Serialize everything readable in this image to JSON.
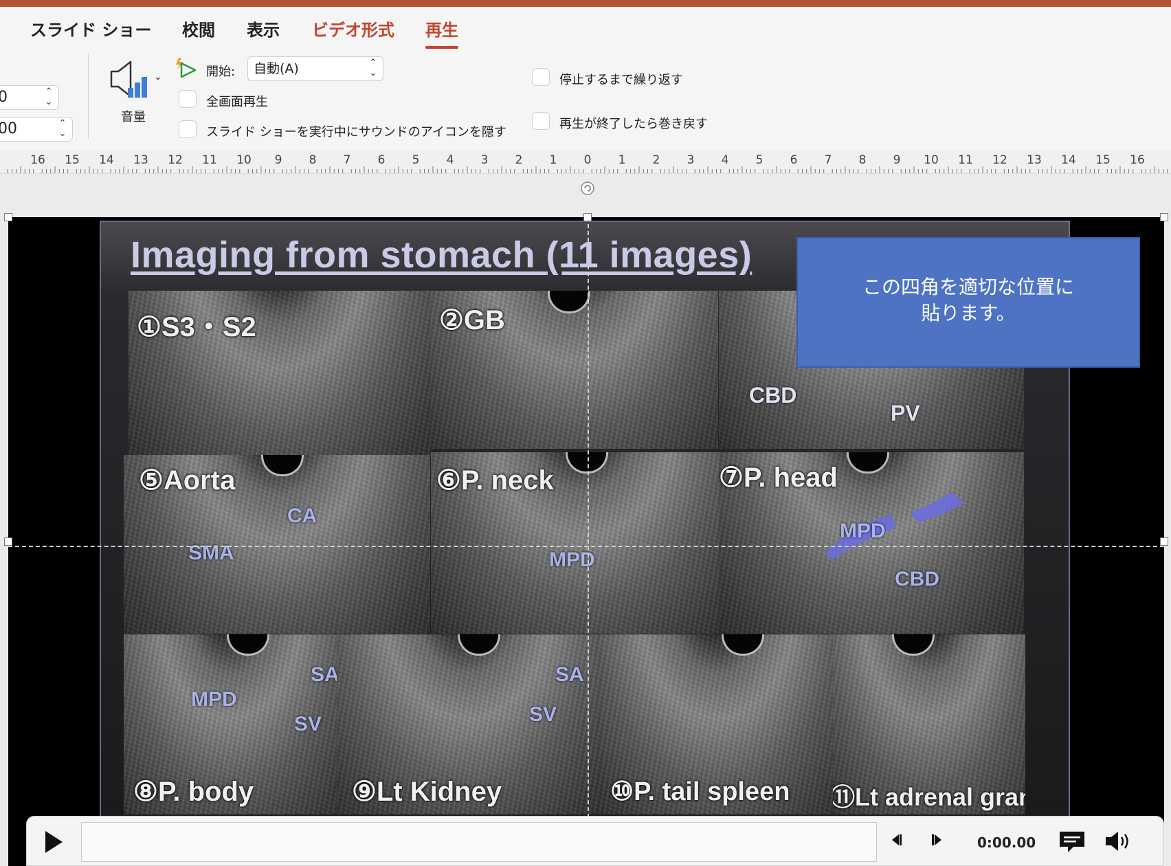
{
  "ribbon": {
    "tabs": [
      {
        "label": "スライド ショー"
      },
      {
        "label": "校閲"
      },
      {
        "label": "表示"
      },
      {
        "label": "ビデオ形式"
      },
      {
        "label": "再生"
      }
    ],
    "active_tab": "再生",
    "fade_in_value": "0",
    "fade_out_value": "00",
    "volume_label": "音量",
    "start_label": "開始:",
    "start_value": "自動(A)",
    "fullscreen_label": "全画面再生",
    "hide_icon_label": "スライド ショーを実行中にサウンドのアイコンを隠す",
    "loop_label": "停止するまで繰り返す",
    "rewind_label": "再生が終了したら巻き戻す",
    "accent_color": "#c0462f"
  },
  "ruler": {
    "left_numbers": [
      "16",
      "15",
      "14",
      "13",
      "12",
      "11",
      "10",
      "9",
      "8",
      "7",
      "6",
      "5",
      "4",
      "3",
      "2",
      "1",
      "0"
    ],
    "right_numbers": [
      "1",
      "2",
      "3",
      "4",
      "5",
      "6",
      "7",
      "8",
      "9",
      "10",
      "11",
      "12",
      "13",
      "14",
      "15",
      "16"
    ]
  },
  "slide": {
    "title": "Imaging from stomach (11 images)",
    "blue_box_text_line1": "この四角を適切な位置に",
    "blue_box_text_line2": "貼ります。",
    "panels": [
      {
        "title": "①S3・S2",
        "labels": []
      },
      {
        "title": "②GB",
        "labels": []
      },
      {
        "title": "",
        "labels": [
          "CBD",
          "PV"
        ]
      },
      {
        "title": "⑤Aorta",
        "labels": [
          "CA",
          "SMA"
        ]
      },
      {
        "title": "⑥P. neck",
        "labels": [
          "MPD"
        ]
      },
      {
        "title": "⑦P. head",
        "labels": [
          "MPD",
          "CBD"
        ]
      },
      {
        "title": "⑧P. body",
        "labels": [
          "MPD",
          "SA",
          "SV"
        ]
      },
      {
        "title": "⑨Lt Kidney",
        "labels": [
          "SA",
          "SV"
        ]
      },
      {
        "title": "⑩P. tail spleen",
        "labels": []
      },
      {
        "title": "⑪Lt adrenal grand",
        "labels": []
      }
    ]
  },
  "player": {
    "time": "0:00.00"
  }
}
